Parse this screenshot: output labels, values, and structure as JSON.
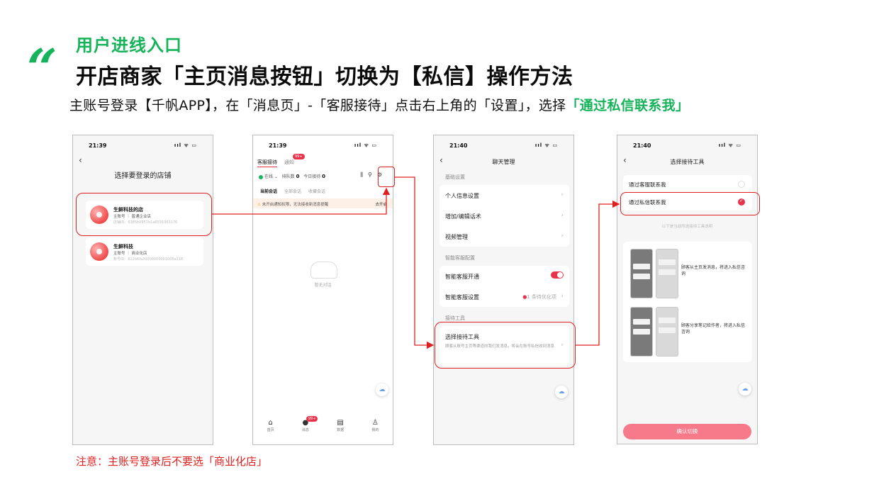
{
  "header": {
    "sup_title": "用户进线入口",
    "main_title": "开店商家「主页消息按钮」切换为【私信】操作方法",
    "subtitle_prefix": "主账号登录【千帆APP】，在「消息页」-「客服接待」点击右上角的「设置」，选择",
    "subtitle_highlight": "「通过私信联系我」"
  },
  "note": "注意：主账号登录后不要选「商业化店」",
  "phone1": {
    "time": "21:39",
    "signal": "ııl ᯤ ▭",
    "title": "选择要登录的店铺",
    "stores": [
      {
        "name": "生鲜科技的店",
        "type": "主账号 ｜ 普通企业店",
        "id": "店铺ID：6385b0957b1a6591063176"
      },
      {
        "name": "生鲜科技",
        "type": "主账号 ｜ 商业化店",
        "id": "账号ID：622b6fa30000000001005a318"
      }
    ]
  },
  "phone2": {
    "time": "21:39",
    "signal": "ııl ᯤ ▭",
    "tab_active": "客服接待",
    "tab_notice": "通知",
    "tab_badge": "99+",
    "online": "在线",
    "queue_label": "排队数",
    "queue_value": "0",
    "today_label": "今日接待",
    "today_value": "0",
    "subtabs": [
      "当前会话",
      "全部会话",
      "收藏会话"
    ],
    "warning": "未开启通知权限，无法接收新消息提醒",
    "warning_action": "去开启",
    "empty_text": "暂无对话",
    "nav": [
      {
        "icon": "⌂",
        "label": "首页"
      },
      {
        "icon": "●",
        "label": "消息",
        "badge": "99+"
      },
      {
        "icon": "▤",
        "label": "数据"
      },
      {
        "icon": "♙",
        "label": "我的"
      }
    ]
  },
  "phone3": {
    "time": "21:40",
    "signal": "ııl ᯤ ▭",
    "title": "聊天管理",
    "section_basic": "基础设置",
    "basic_items": [
      "个人信息设置",
      "增加/编辑话术",
      "视频管理"
    ],
    "section_smart": "智能客服配置",
    "smart_enable": "智能客服开通",
    "smart_settings": "智能客服设置",
    "pending_text": "1 条待优化项",
    "section_tools": "接待工具",
    "tool_title": "选择接待工具",
    "tool_desc": "顾客从账号主页等渠道向我们发消息，将会在账号私信收到消息"
  },
  "phone4": {
    "time": "21:40",
    "signal": "ııl ᯤ ▭",
    "title": "选择接待工具",
    "option_service": "通过客服联系我",
    "option_dm": "通过私信联系我",
    "hint": "以下是当前所选接待工具说明",
    "demo_1": "顾客从主页发消息，将进入私信咨询",
    "demo_2": "顾客分享笔记给作者，将进入私信咨询",
    "confirm": "确认切换"
  },
  "colors": {
    "accent_green": "#17b35a",
    "highlight_red": "#e02020",
    "brand_red": "#e8344a"
  }
}
